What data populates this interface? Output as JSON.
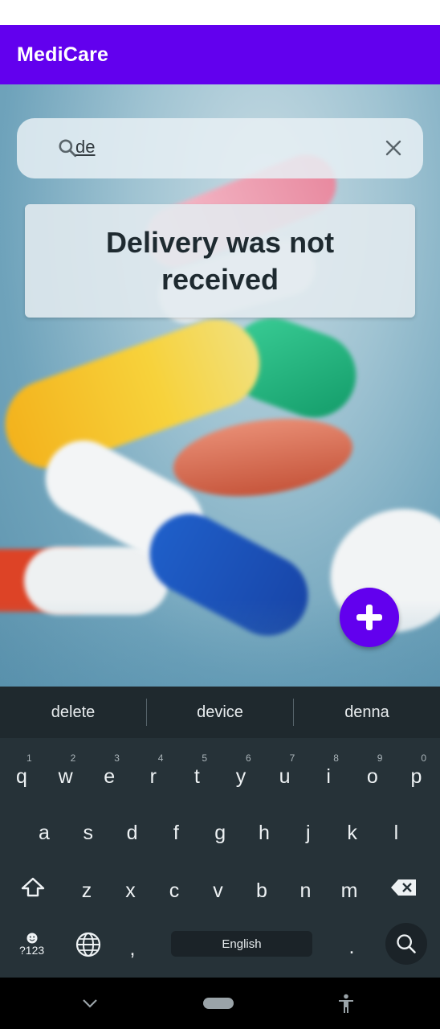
{
  "app_bar": {
    "title": "MediCare",
    "color": "#6200ee"
  },
  "search": {
    "value": "de"
  },
  "result": {
    "text": "Delivery was not received"
  },
  "fab": {
    "label": "+"
  },
  "keyboard": {
    "suggestions": [
      "delete",
      "device",
      "denna"
    ],
    "row1": [
      "q",
      "w",
      "e",
      "r",
      "t",
      "y",
      "u",
      "i",
      "o",
      "p"
    ],
    "row1_numbers": [
      "1",
      "2",
      "3",
      "4",
      "5",
      "6",
      "7",
      "8",
      "9",
      "0"
    ],
    "row2": [
      "a",
      "s",
      "d",
      "f",
      "g",
      "h",
      "j",
      "k",
      "l"
    ],
    "row3": [
      "z",
      "x",
      "c",
      "v",
      "b",
      "n",
      "m"
    ],
    "symbols_label": "?123",
    "comma": ",",
    "space_label": "English",
    "period": "."
  },
  "icons": {
    "search": "search-icon",
    "clear": "close-icon",
    "add": "plus-icon",
    "shift": "shift-icon",
    "backspace": "backspace-icon",
    "globe": "globe-icon",
    "emoji": "emoji-icon",
    "keyboard_search": "search-icon",
    "nav_back": "chevron-down-icon",
    "nav_home": "home-pill-icon",
    "nav_accessibility": "accessibility-icon"
  }
}
